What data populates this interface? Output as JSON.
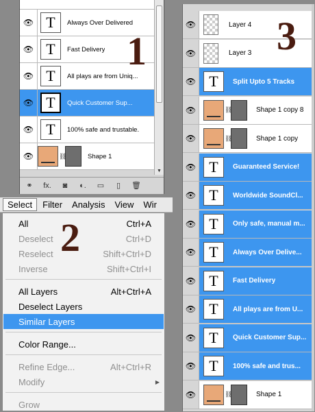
{
  "panel1": {
    "rows": [
      {
        "type": "text",
        "name": "Always Over Delivered",
        "selected": false
      },
      {
        "type": "text",
        "name": "Fast Delivery",
        "selected": false
      },
      {
        "type": "text",
        "name": "All plays are from Uniq...",
        "selected": false
      },
      {
        "type": "text",
        "name": "Quick Customer Sup...",
        "selected": true
      },
      {
        "type": "text",
        "name": "100% safe and trustable.",
        "selected": false
      },
      {
        "type": "shape",
        "name": "Shape 1",
        "selected": false
      }
    ],
    "footer_icons": [
      "link-icon",
      "fx-icon",
      "mask-icon",
      "adjustment-icon",
      "group-folder-icon",
      "new-layer-icon",
      "trash-icon"
    ],
    "footer_glyphs": [
      "⚭",
      "fx.",
      "◙",
      "◐.",
      "▭",
      "▯",
      "🗑"
    ]
  },
  "menubar": {
    "items": [
      "Select",
      "Filter",
      "Analysis",
      "View",
      "Wir"
    ]
  },
  "select_menu": {
    "items": [
      {
        "label": "All",
        "shortcut": "Ctrl+A",
        "disabled": false
      },
      {
        "label": "Deselect",
        "shortcut": "Ctrl+D",
        "disabled": true
      },
      {
        "label": "Reselect",
        "shortcut": "Shift+Ctrl+D",
        "disabled": true
      },
      {
        "label": "Inverse",
        "shortcut": "Shift+Ctrl+I",
        "disabled": true
      },
      {
        "label": "All Layers",
        "shortcut": "Alt+Ctrl+A",
        "disabled": false
      },
      {
        "label": "Deselect Layers",
        "shortcut": "",
        "disabled": false
      },
      {
        "label": "Similar Layers",
        "shortcut": "",
        "disabled": false,
        "highlighted": true
      },
      {
        "label": "Color Range...",
        "shortcut": "",
        "disabled": false
      },
      {
        "label": "Refine Edge...",
        "shortcut": "Alt+Ctrl+R",
        "disabled": true
      },
      {
        "label": "Modify",
        "shortcut": "",
        "disabled": true,
        "submenu": true
      },
      {
        "label": "Grow",
        "shortcut": "",
        "disabled": true
      }
    ]
  },
  "panel3": {
    "rows": [
      {
        "type": "transparent",
        "name": "Layer 4",
        "selected": false
      },
      {
        "type": "transparent",
        "name": "Layer 3",
        "selected": false
      },
      {
        "type": "text",
        "name": "Split Upto 5 Tracks",
        "selected": true
      },
      {
        "type": "shape",
        "name": "Shape 1 copy 8",
        "selected": false
      },
      {
        "type": "shape",
        "name": "Shape 1 copy",
        "selected": false
      },
      {
        "type": "text",
        "name": "Guaranteed Service!",
        "selected": true
      },
      {
        "type": "text",
        "name": "Worldwide SoundCl...",
        "selected": true
      },
      {
        "type": "text",
        "name": "Only safe, manual m...",
        "selected": true
      },
      {
        "type": "text",
        "name": "Always Over Delive...",
        "selected": true
      },
      {
        "type": "text",
        "name": "Fast Delivery",
        "selected": true
      },
      {
        "type": "text",
        "name": "All plays are from U...",
        "selected": true
      },
      {
        "type": "text",
        "name": "Quick Customer Sup...",
        "selected": true
      },
      {
        "type": "text",
        "name": "100% safe and trus...",
        "selected": true
      },
      {
        "type": "shape",
        "name": "Shape 1",
        "selected": false
      }
    ]
  },
  "annotations": {
    "one": "1",
    "two": "2",
    "three": "3"
  },
  "colors": {
    "selection": "#3d96ef",
    "annotation": "#4a1c10",
    "shape_fill": "#e8a878"
  }
}
